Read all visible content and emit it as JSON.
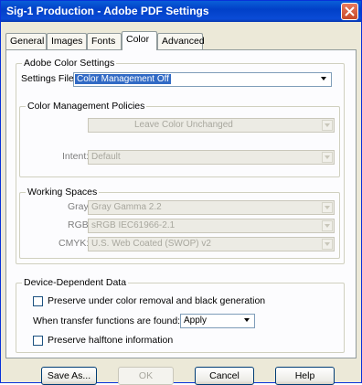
{
  "window": {
    "title": "Sig-1 Production - Adobe PDF Settings"
  },
  "tabs": [
    "General",
    "Images",
    "Fonts",
    "Color",
    "Advanced"
  ],
  "adobe_color": {
    "legend": "Adobe Color Settings",
    "settings_label": "Settings File:",
    "settings_value": "Color Management Off"
  },
  "policies": {
    "legend": "Color Management Policies",
    "policy_value": "Leave Color Unchanged",
    "intent_label": "Intent:",
    "intent_value": "Default"
  },
  "working_spaces": {
    "legend": "Working Spaces",
    "gray_label": "Gray:",
    "gray_value": "Gray Gamma 2.2",
    "rgb_label": "RGB:",
    "rgb_value": "sRGB IEC61966-2.1",
    "cmyk_label": "CMYK:",
    "cmyk_value": "U.S. Web Coated (SWOP) v2"
  },
  "device": {
    "legend": "Device-Dependent Data",
    "ucr_label": "Preserve under color removal and black generation",
    "transfer_label": "When transfer functions are found:",
    "transfer_value": "Apply",
    "halftone_label": "Preserve halftone information"
  },
  "buttons": {
    "save_as": "Save As...",
    "ok": "OK",
    "cancel": "Cancel",
    "help": "Help"
  }
}
